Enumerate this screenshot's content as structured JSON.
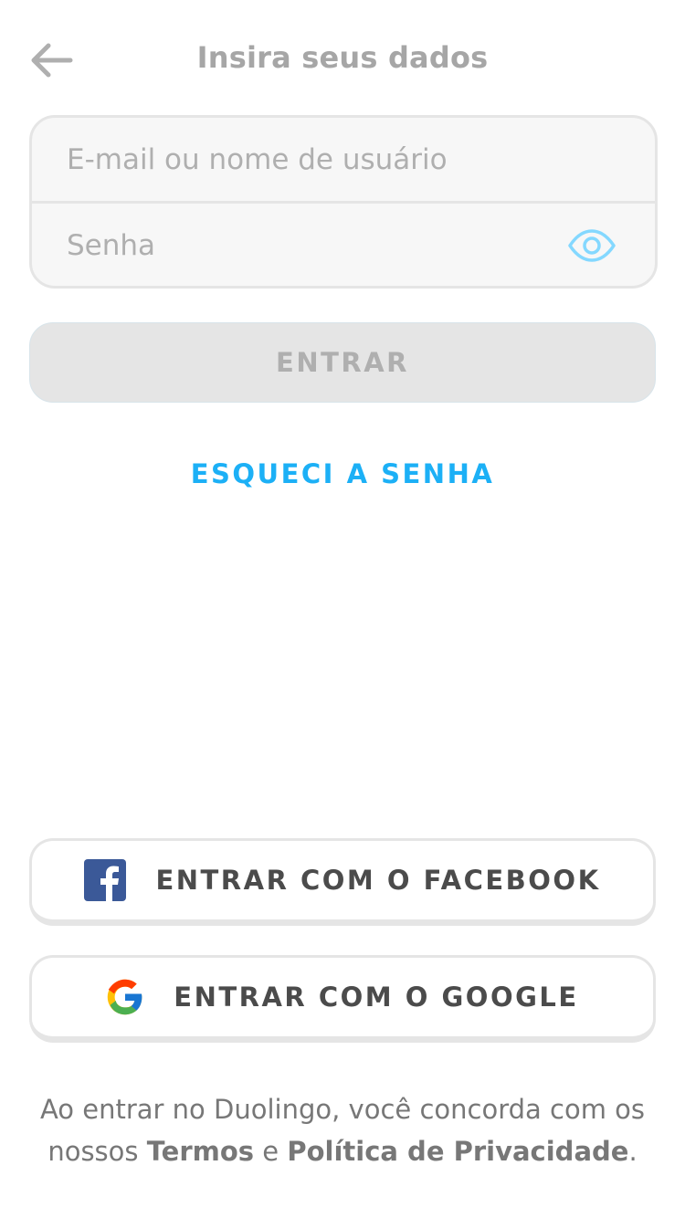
{
  "header": {
    "title": "Insira seus dados",
    "back_icon": "arrow-left-icon"
  },
  "form": {
    "username_placeholder": "E-mail ou nome de usuário",
    "username_value": "",
    "password_placeholder": "Senha",
    "password_value": "",
    "toggle_icon": "eye-icon"
  },
  "actions": {
    "submit_label": "ENTRAR",
    "forgot_label": "ESQUECI A SENHA"
  },
  "social": {
    "facebook_label": "ENTRAR COM O FACEBOOK",
    "facebook_icon": "facebook-icon",
    "google_label": "ENTRAR COM O GOOGLE",
    "google_icon": "google-icon"
  },
  "legal": {
    "prefix": "Ao entrar no Duolingo, você concorda com os nossos ",
    "terms": "Termos",
    "conjunction": " e ",
    "privacy": "Política de Privacidade",
    "suffix": "."
  },
  "colors": {
    "accent": "#1cb0f6",
    "disabled": "#e5e5e5",
    "text_muted": "#afafaf",
    "text_dark": "#4b4b4b",
    "facebook": "#3b5998"
  }
}
